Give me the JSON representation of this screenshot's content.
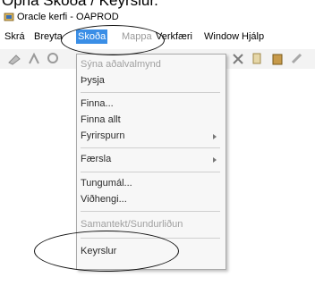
{
  "caption": "Opna Skoða / Keyrslur.",
  "window": {
    "title": "Oracle kerfi - OAPROD"
  },
  "menubar": [
    {
      "label": "Skrá",
      "state": "normal"
    },
    {
      "label": "Breyta",
      "state": "normal"
    },
    {
      "label": "Skoða",
      "state": "active"
    },
    {
      "label": "Mappa",
      "state": "disabled"
    },
    {
      "label": "Verkfæri",
      "state": "normal"
    },
    {
      "label": "Window",
      "state": "normal"
    },
    {
      "label": "Hjálp",
      "state": "normal"
    }
  ],
  "toolbar_icons": [
    "save-icon",
    "navigate-icon",
    "zoom-icon",
    "cut-icon",
    "copy-icon",
    "paste-icon",
    "clear-icon"
  ],
  "dropdown": [
    {
      "label": "Sýna aðalvalmynd",
      "state": "disabled"
    },
    {
      "label": "Þysja",
      "state": "normal"
    },
    {
      "separator": true
    },
    {
      "label": "Finna...",
      "state": "normal"
    },
    {
      "label": "Finna allt",
      "state": "normal"
    },
    {
      "label": "Fyrirspurn",
      "state": "normal",
      "submenu": true
    },
    {
      "separator": true
    },
    {
      "label": "Færsla",
      "state": "normal",
      "submenu": true
    },
    {
      "separator": true
    },
    {
      "label": "Tungumál...",
      "state": "normal"
    },
    {
      "label": "Viðhengi...",
      "state": "normal"
    },
    {
      "separator": true
    },
    {
      "label": "Samantekt/Sundurliðun",
      "state": "disabled"
    },
    {
      "separator": true
    },
    {
      "label": "Keyrslur",
      "state": "normal"
    }
  ],
  "colors": {
    "active_menu_bg": "#3a8ee6",
    "disabled_text": "#a0a0a0"
  }
}
